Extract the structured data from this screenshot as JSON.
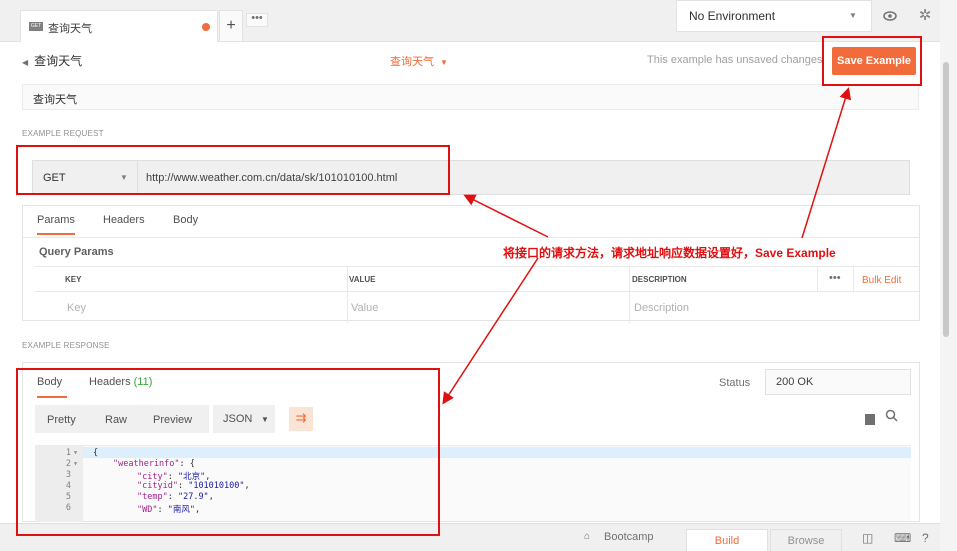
{
  "tab": {
    "badge": "GET",
    "label": "查询天气",
    "new_tab": "+",
    "more": "•••"
  },
  "environment": {
    "label": "No Environment",
    "caret": "▼",
    "eye_icon": "eye-icon",
    "gear_icon": "gear-icon"
  },
  "header": {
    "back_label": "查询天气",
    "request_name": "查询天气",
    "caret": "▼",
    "unsaved_text": "This example has unsaved changes",
    "save_label": "Save Example",
    "example_name": "查询天气"
  },
  "request": {
    "section_label": "EXAMPLE REQUEST",
    "method": "GET",
    "url": "http://www.weather.com.cn/data/sk/101010100.html",
    "tabs": [
      "Params",
      "Headers",
      "Body"
    ],
    "query_params_title": "Query Params",
    "columns": {
      "key": "KEY",
      "value": "VALUE",
      "description": "DESCRIPTION"
    },
    "placeholders": {
      "key": "Key",
      "value": "Value",
      "description": "Description"
    },
    "more": "•••",
    "bulk_edit": "Bulk Edit"
  },
  "response": {
    "section_label": "EXAMPLE RESPONSE",
    "tabs": {
      "body": "Body",
      "headers": "Headers",
      "headers_count": "(11)"
    },
    "status_label": "Status",
    "status_value": "200 OK",
    "formats": [
      "Pretty",
      "Raw",
      "Preview"
    ],
    "language": "JSON",
    "lines": [
      {
        "num": "1",
        "fold": "▾",
        "text": "{"
      },
      {
        "num": "2",
        "fold": "▾",
        "key": "\"weatherinfo\"",
        "rest": ": {"
      },
      {
        "num": "3",
        "fold": "",
        "key": "\"city\"",
        "sep": ": ",
        "val": "\"北京\"",
        "end": ","
      },
      {
        "num": "4",
        "fold": "",
        "key": "\"cityid\"",
        "sep": ": ",
        "val": "\"101010100\"",
        "end": ","
      },
      {
        "num": "5",
        "fold": "",
        "key": "\"temp\"",
        "sep": ": ",
        "val": "\"27.9\"",
        "end": ","
      },
      {
        "num": "6",
        "fold": "",
        "key": "\"WD\"",
        "sep": ": ",
        "val": "\"南风\"",
        "end": ","
      }
    ]
  },
  "annotation": {
    "text": "将接口的请求方法，请求地址响应数据设置好，Save Example",
    "color": "#e01010"
  },
  "statusbar": {
    "bootcamp": "Bootcamp",
    "build": "Build",
    "browse": "Browse"
  },
  "colors": {
    "accent": "#f26b3a",
    "annotation": "#e01010"
  }
}
